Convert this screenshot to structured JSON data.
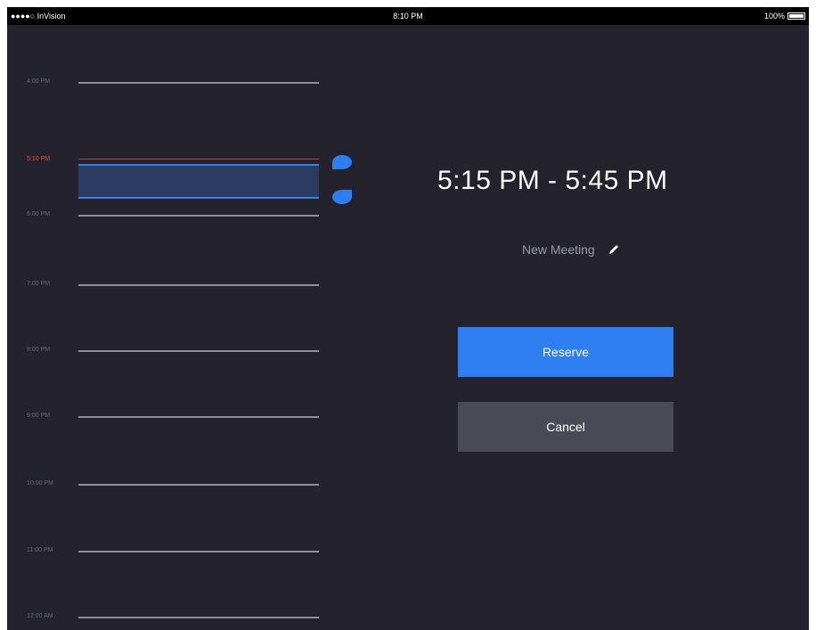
{
  "status_bar": {
    "carrier": "●●●●○ InVision",
    "time": "8:10 PM",
    "battery": "100%",
    "wifi_icon": "wifi-icon",
    "battery_icon": "battery-icon"
  },
  "timeline": {
    "hours": [
      "4:00 PM",
      "5:10 PM",
      "6:00 PM",
      "7:00 PM",
      "8:00 PM",
      "9:00 PM",
      "10:00 PM",
      "11:00 PM",
      "12:00 AM"
    ],
    "current_time_label": "5:10 PM",
    "current_time_color": "#e2563a",
    "selection_color": "#2f7df5"
  },
  "booking": {
    "range": "5:15 PM - 5:45 PM",
    "meeting_name": "New Meeting",
    "edit_icon": "pencil-icon",
    "reserve_label": "Reserve",
    "cancel_label": "Cancel"
  },
  "colors": {
    "background": "#23222d",
    "accent": "#2f7ef2",
    "cancel_bg": "#4a4a57"
  }
}
